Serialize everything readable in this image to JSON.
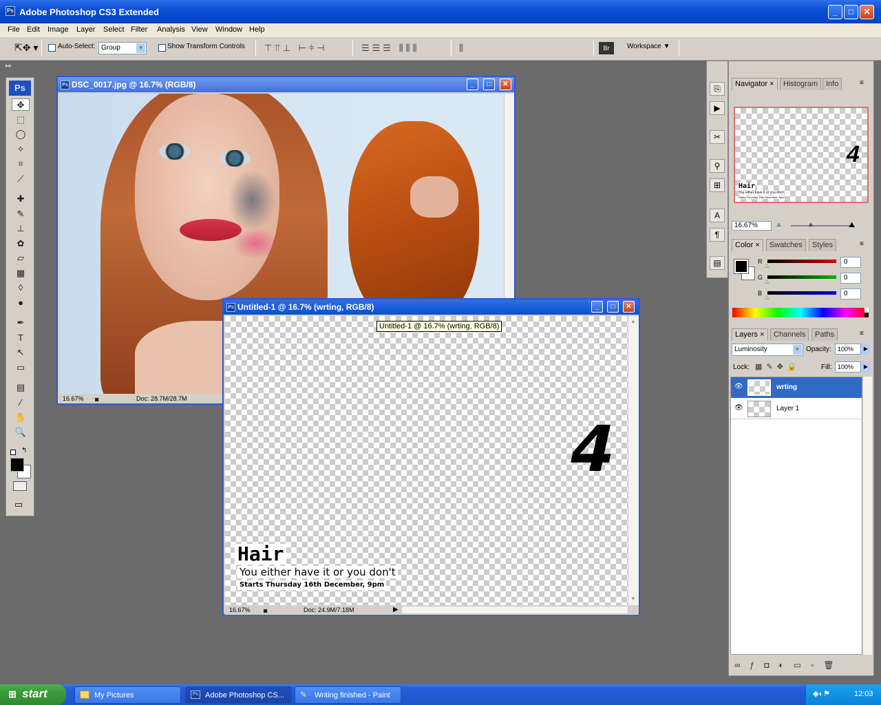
{
  "app": {
    "title": "Adobe Photoshop CS3 Extended",
    "logo": "Ps",
    "window_buttons": {
      "minimize": "_",
      "maximize": "□",
      "close": "✕"
    }
  },
  "menu": [
    "File",
    "Edit",
    "Image",
    "Layer",
    "Select",
    "Filter",
    "Analysis",
    "View",
    "Window",
    "Help"
  ],
  "options_bar": {
    "auto_select_label": "Auto-Select:",
    "auto_select_value": "Group",
    "show_transform_label": "Show Transform Controls",
    "workspace_label": "Workspace ▼"
  },
  "toolbox": {
    "logo": "Ps",
    "tools": [
      "move-tool",
      "marquee-tool",
      "lasso-tool",
      "magic-wand-tool",
      "crop-tool",
      "slice-tool",
      "healing-brush-tool",
      "brush-tool",
      "clone-stamp-tool",
      "history-brush-tool",
      "eraser-tool",
      "gradient-tool",
      "blur-tool",
      "dodge-tool",
      "pen-tool",
      "type-tool",
      "path-selection-tool",
      "shape-tool",
      "notes-tool",
      "eyedropper-tool",
      "hand-tool",
      "zoom-tool"
    ],
    "glyphs": [
      "✥",
      "⬚",
      "◯",
      "✧",
      "⌗",
      "⟋",
      "✚",
      "✎",
      "⊥",
      "✿",
      "▱",
      "▦",
      "◊",
      "●",
      "✒",
      "T",
      "↖",
      "▭",
      "▤",
      "⁄",
      "✋",
      "🔍"
    ]
  },
  "doc1": {
    "title": "DSC_0017.jpg @ 16.7% (RGB/8)",
    "zoom": "16.67%",
    "doc_size": "Doc: 28.7M/28.7M"
  },
  "doc2": {
    "title": "Untitled-1 @ 16.7% (wrting, RGB/8)",
    "tooltip": "Untitled-1 @ 16.7% (wrting, RGB/8)",
    "zoom": "16.67%",
    "doc_size": "Doc: 24.9M/7.18M",
    "poster": {
      "heading": "Hair",
      "tagline": "You either have it or you don't",
      "date_line": "Starts Thursday 16th December, 9pm",
      "logo_text": "4"
    }
  },
  "navigator": {
    "tabs": [
      "Navigator",
      "Histogram",
      "Info"
    ],
    "zoom": "16.67%",
    "preview_heading": "Hair",
    "preview_line1": "You either have it or you don't",
    "preview_line2": "Starts Thursday 16th December, 9pm",
    "zoom_level": 0.3
  },
  "color_panel": {
    "tabs": [
      "Color",
      "Swatches",
      "Styles"
    ],
    "channels": [
      {
        "label": "R",
        "value": "0",
        "color": "#d40000"
      },
      {
        "label": "G",
        "value": "0",
        "color": "#00b000"
      },
      {
        "label": "B",
        "value": "0",
        "color": "#0000d0"
      }
    ]
  },
  "layers_panel": {
    "tabs": [
      "Layers",
      "Channels",
      "Paths"
    ],
    "blend_mode": "Luminosity",
    "opacity_label": "Opacity:",
    "opacity_value": "100%",
    "lock_label": "Lock:",
    "fill_label": "Fill:",
    "fill_value": "100%",
    "layers": [
      {
        "name": "wrting",
        "selected": true
      },
      {
        "name": "Layer 1",
        "selected": false
      }
    ]
  },
  "taskbar": {
    "start_label": "start",
    "tasks": [
      {
        "label": "My Pictures",
        "active": false
      },
      {
        "label": "Adobe Photoshop CS...",
        "active": true
      },
      {
        "label": "Writing finished - Paint",
        "active": false
      }
    ],
    "clock": "12:03"
  }
}
